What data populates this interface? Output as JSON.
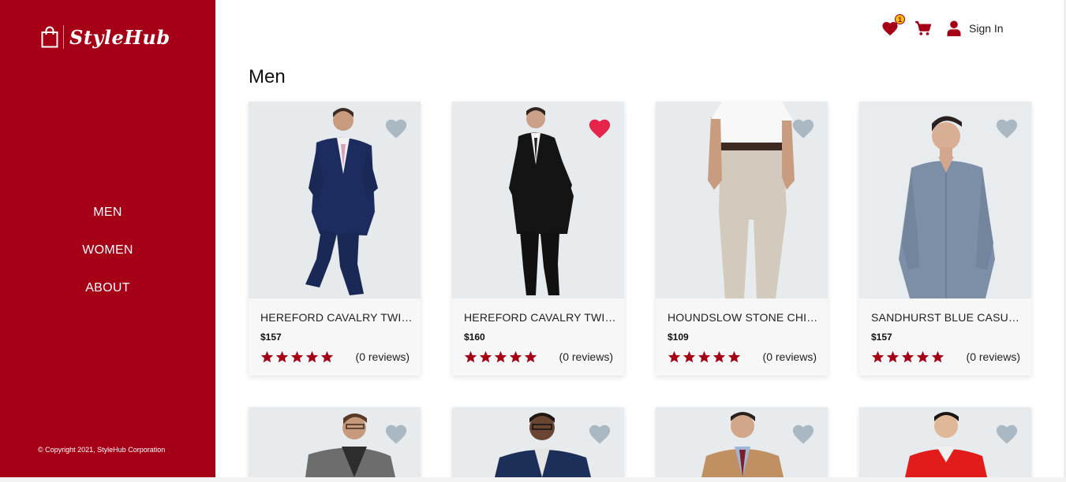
{
  "brand": {
    "name": "StyleHub"
  },
  "sidebar": {
    "nav": [
      {
        "label": "MEN"
      },
      {
        "label": "WOMEN"
      },
      {
        "label": "ABOUT"
      }
    ],
    "copyright": "© Copyright 2021, StyleHub Corporation"
  },
  "header": {
    "wishlist_count": "1",
    "signin_label": "Sign In"
  },
  "page": {
    "title": "Men"
  },
  "products": [
    {
      "name": "HEREFORD CAVALRY TWILL SUIT",
      "price": "$157",
      "rating": 5,
      "reviews": "(0 reviews)",
      "favorited": false,
      "outfit": "navy suit"
    },
    {
      "name": "HEREFORD CAVALRY TWILL SUIT",
      "price": "$160",
      "rating": 5,
      "reviews": "(0 reviews)",
      "favorited": true,
      "outfit": "black suit"
    },
    {
      "name": "HOUNDSLOW STONE CHINO",
      "price": "$109",
      "rating": 5,
      "reviews": "(0 reviews)",
      "favorited": false,
      "outfit": "stone chino"
    },
    {
      "name": "SANDHURST BLUE CASUAL SHIRT",
      "price": "$157",
      "rating": 5,
      "reviews": "(0 reviews)",
      "favorited": false,
      "outfit": "blue shirt"
    },
    {
      "favorited": false,
      "outfit": "tweed blazer"
    },
    {
      "favorited": false,
      "outfit": "navy blazer"
    },
    {
      "favorited": false,
      "outfit": "camel coat"
    },
    {
      "favorited": false,
      "outfit": "red jacket"
    }
  ],
  "colors": {
    "brand": "#a50016",
    "heart_active": "#e5254a",
    "heart_inactive": "#a9b8c2",
    "badge": "#f4c10b"
  },
  "icons": {
    "wishlist": "heart-icon",
    "cart": "cart-icon",
    "user": "user-icon",
    "logo": "shopping-bag-icon",
    "rating": "star-icon"
  }
}
